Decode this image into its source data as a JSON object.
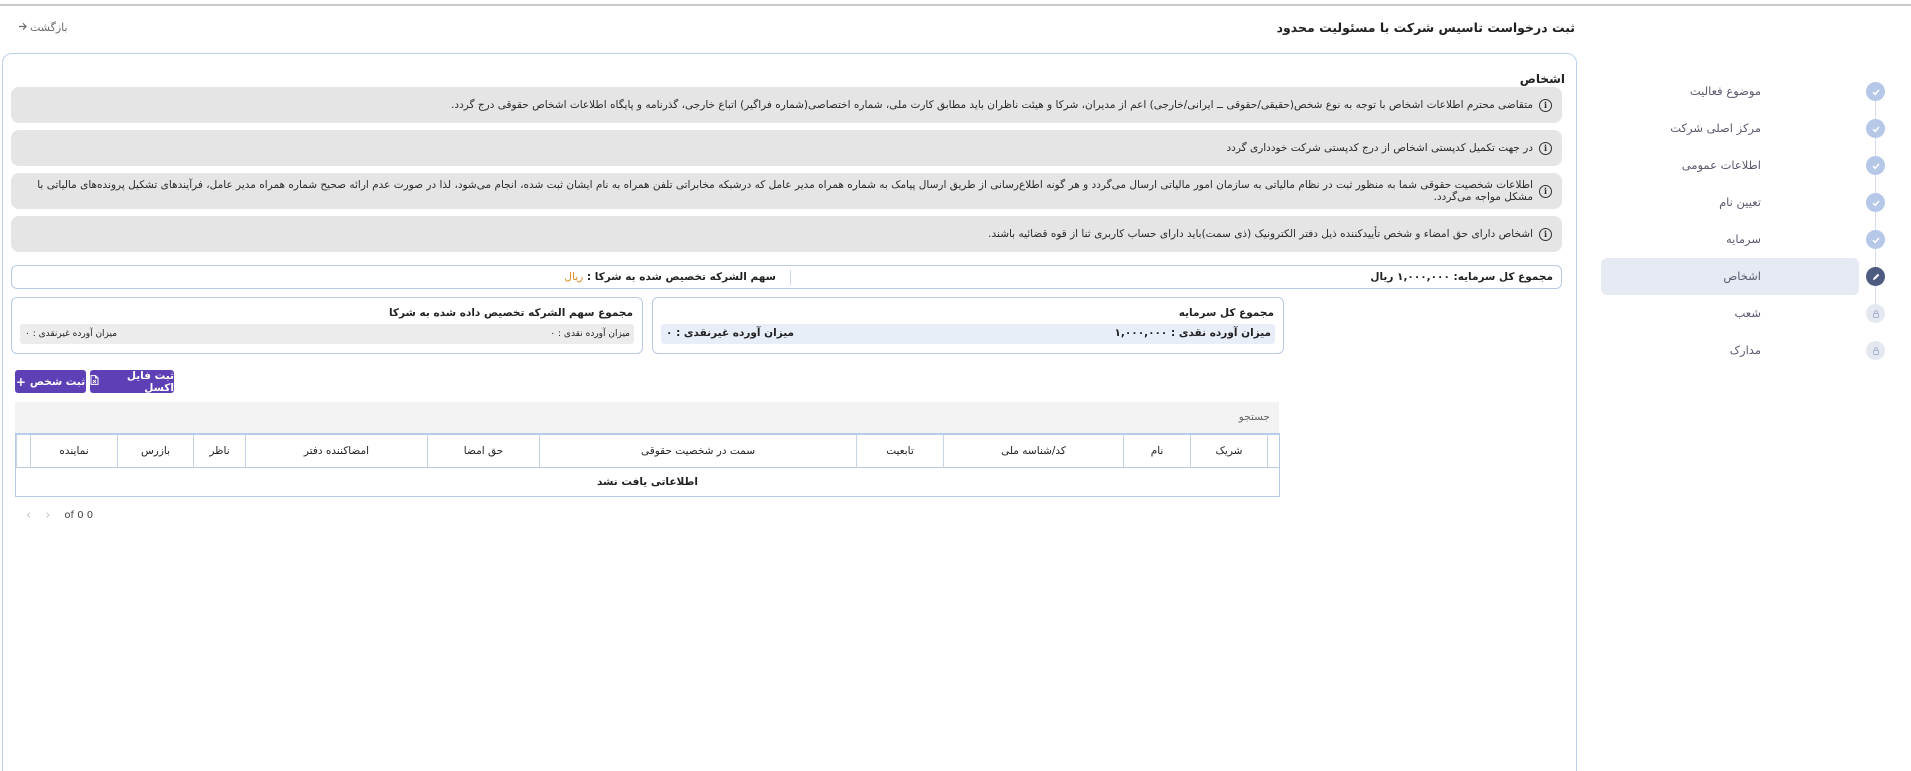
{
  "header": {
    "title": "ثبت درخواست تاسیس شرکت با مسئولیت محدود",
    "back_label": "بازگشت",
    "back_icon": "arrow-right-icon"
  },
  "steps": [
    {
      "label": "موضوع فعالیت",
      "state": "done"
    },
    {
      "label": "مرکز اصلی شرکت",
      "state": "done"
    },
    {
      "label": "اطلاعات عمومی",
      "state": "done"
    },
    {
      "label": "تعیین نام",
      "state": "done"
    },
    {
      "label": "سرمایه",
      "state": "done"
    },
    {
      "label": "اشخاص",
      "state": "active"
    },
    {
      "label": "شعب",
      "state": "locked"
    },
    {
      "label": "مدارک",
      "state": "locked"
    }
  ],
  "section": {
    "title": "اشخاص"
  },
  "notices": [
    "متقاضی محترم اطلاعات اشخاص با توجه به نوع شخص(حقیقی/حقوقی ــ ایرانی/خارجی) اعم از مدیران، شرکا و هیئت ناظران باید مطابق کارت ملی، شماره اختصاصی(شماره فراگیر) اتباع خارجی، گذرنامه و پایگاه اطلاعات اشخاص حقوقی درج گردد.",
    "در جهت تکمیل کدپستی اشخاص از درج کدپستی شرکت خودداری گردد",
    "اطلاعات شخصیت حقوقی شما به منظور ثبت در نظام مالیاتی به سازمان امور مالیاتی ارسال می‌گردد و هر گونه اطلاع‌رسانی از طریق ارسال پیامک به شماره همراه مدیر عامل که درشبکه مخابراتی تلفن همراه به نام ایشان ثبت شده، انجام می‌شود، لذا در صورت عدم ارائه صحیح شماره همراه مدیر عامل، فرآیندهای تشکیل پرونده‌های مالیاتی با مشکل مواجه می‌گردد.",
    "اشخاص دارای حق امضاء و شخص تأییدکننده ذیل دفتر الکترونیک (ذی سمت)باید دارای حساب کاربری ثنا از قوه قضائیه باشند."
  ],
  "totals": {
    "total_capital": "مجموع کل سرمایه: ۱,۰۰۰,۰۰۰ ریال",
    "allocated_label": "سهم الشرکه تخصیص شده به شرکا :",
    "allocated_value": "ریال"
  },
  "capital_box": {
    "title": "مجموع کل سرمایه",
    "cash": "میزان آورده نقدی : ۱,۰۰۰,۰۰۰",
    "non_cash": "میزان آورده غیرنقدی : ۰"
  },
  "shares_box": {
    "title": "مجموع سهم الشرکه تخصیص داده شده به شرکا",
    "cash": "میزان آورده نقدی : ۰",
    "non_cash": "میزان آورده غیرنقدی : ۰"
  },
  "buttons": {
    "add_person": "ثبت شخص",
    "excel": "ثبت فایل اکسل"
  },
  "search": {
    "placeholder": "جستجو"
  },
  "table": {
    "columns": [
      "شریک",
      "نام",
      "کد/شناسه ملی",
      "تابعیت",
      "سمت در شخصیت حقوقی",
      "حق امضا",
      "امضاکننده دفتر",
      "ناظر",
      "بازرس",
      "نماینده"
    ],
    "empty": "اطلاعاتی یافت نشد"
  },
  "pagination": {
    "label": "of 0 0"
  }
}
